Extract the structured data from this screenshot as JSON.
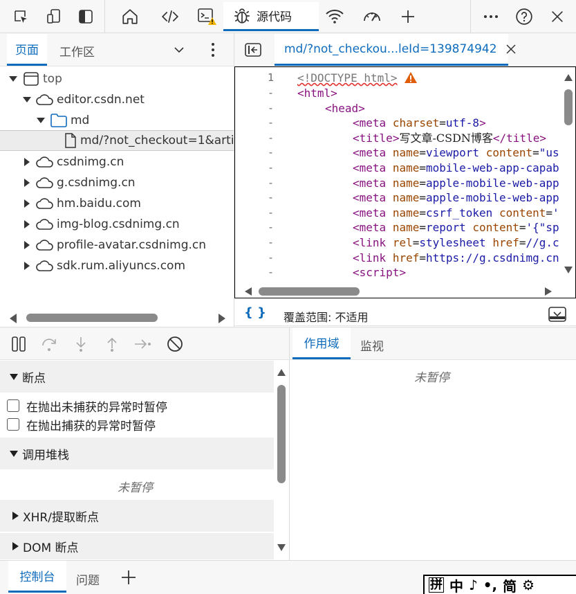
{
  "toolbar": {
    "active_tab": "源代码",
    "colors": {
      "accent": "#0f6cbd",
      "warning": "#f2b600"
    }
  },
  "navigator": {
    "tabs": [
      "页面",
      "工作区"
    ],
    "tree": [
      {
        "label": "top",
        "icon": "frame-icon",
        "expanded": true
      },
      {
        "label": "editor.csdn.net",
        "icon": "cloud-icon",
        "expanded": true
      },
      {
        "label": "md",
        "icon": "folder-icon",
        "expanded": true
      },
      {
        "label": "md/?not_checkout=1&artic",
        "icon": "file-icon",
        "selected": true
      },
      {
        "label": "csdnimg.cn",
        "icon": "cloud-icon"
      },
      {
        "label": "g.csdnimg.cn",
        "icon": "cloud-icon"
      },
      {
        "label": "hm.baidu.com",
        "icon": "cloud-icon"
      },
      {
        "label": "img-blog.csdnimg.cn",
        "icon": "cloud-icon"
      },
      {
        "label": "profile-avatar.csdnimg.cn",
        "icon": "cloud-icon"
      },
      {
        "label": "sdk.rum.aliyuncs.com",
        "icon": "cloud-icon"
      }
    ]
  },
  "editor": {
    "file_tab": "md/?not_checkou...leId=139874942",
    "gutter": [
      "1",
      "-",
      "-",
      "-",
      "-",
      "-",
      "-",
      "-",
      "-",
      "-",
      "-",
      "-",
      "-",
      "-"
    ],
    "code": {
      "l1": "<!DOCTYPE html>",
      "l2": "<html>",
      "l3": "<head>",
      "l4_tag": "meta",
      "l4_attr": "charset",
      "l4_val": "utf-8",
      "l5_open": "title",
      "l5_text": "写文章-CSDN博客",
      "l5_close": "title",
      "l6_attr": "name",
      "l6_val": "viewport",
      "l6_attr2": "content",
      "l6_val2": "\"us",
      "l7_val": "mobile-web-app-capab",
      "l8_val": "apple-mobile-web-app",
      "l9_val": "apple-mobile-web-app",
      "l10_val": "csrf_token",
      "l10_val2": "'",
      "l11_val": "report",
      "l11_val2": "'{\"sp",
      "l12_tag": "link",
      "l12_attr": "rel",
      "l12_val": "stylesheet",
      "l12_attr2": "href",
      "l12_val2": "//g.c",
      "l13_val": "https://g.csdnimg.cn",
      "l14": "script"
    },
    "coverage": "覆盖范围: 不适用",
    "format_label": "{ }"
  },
  "debugger": {
    "sections": {
      "breakpoints": "断点",
      "uncaught": "在抛出未捕获的异常时暂停",
      "caught": "在抛出捕获的异常时暂停",
      "callstack": "调用堆栈",
      "not_paused": "未暂停",
      "xhr": "XHR/提取断点",
      "dom": "DOM 断点"
    },
    "scope_tabs": [
      "作用域",
      "监视"
    ],
    "scope_not_paused": "未暂停"
  },
  "drawer": {
    "tabs": [
      "控制台",
      "问题"
    ],
    "add": "+"
  },
  "ime": {
    "items": [
      "拼",
      "中",
      "♪",
      "•,",
      "简",
      "⚙"
    ]
  }
}
